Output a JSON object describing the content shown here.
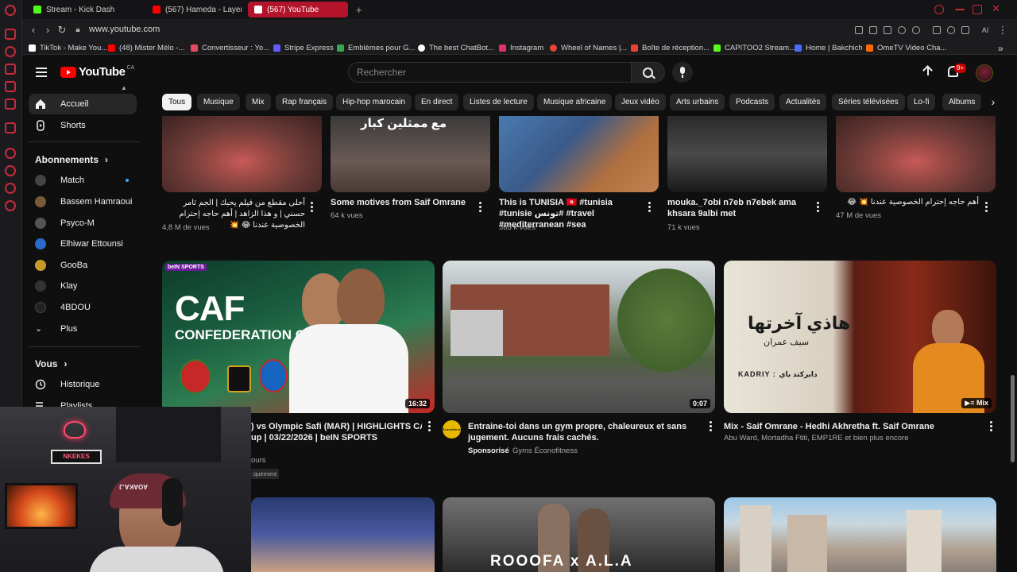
{
  "browser": {
    "tabs": [
      {
        "label": "Stream - Kick Dashboard",
        "color": "#53fc18"
      },
      {
        "label": "(567) Hameda - Layen",
        "color": "#ff0000"
      },
      {
        "label": "(567) YouTube",
        "color": "#ff0000",
        "active": true
      }
    ],
    "url": "www.youtube.com",
    "bookmarks": [
      {
        "label": "TikTok - Make You...",
        "color": "#ffffff"
      },
      {
        "label": "(48) Mister Mélo -...",
        "color": "#ff0000"
      },
      {
        "label": "Convertisseur : Yo...",
        "color": "#e84a5f"
      },
      {
        "label": "Stripe Express",
        "color": "#635bff"
      },
      {
        "label": "Emblèmes pour G...",
        "color": "#34a853"
      },
      {
        "label": "The best ChatBot...",
        "color": "#ffffff"
      },
      {
        "label": "Instagram",
        "color": "#e1306c"
      },
      {
        "label": "Wheel of Names |...",
        "color": "#ea4335"
      },
      {
        "label": "Boîte de réception...",
        "color": "#ea4335"
      },
      {
        "label": "CAPITOO2 Stream...",
        "color": "#53fc18"
      },
      {
        "label": "Home | Bakchich",
        "color": "#4a6cf7"
      },
      {
        "label": "OmeTV Video Cha...",
        "color": "#ff6a00"
      }
    ]
  },
  "header": {
    "logo_text": "YouTube",
    "logo_country": "CA",
    "search_placeholder": "Rechercher",
    "notification_count": "9+"
  },
  "sidebar": {
    "home": "Accueil",
    "shorts": "Shorts",
    "subscriptions_heading": "Abonnements",
    "channels": [
      {
        "name": "Match",
        "color": "#444444",
        "live_dot": true
      },
      {
        "name": "Bassem Hamraoui",
        "color": "#7a5a3a"
      },
      {
        "name": "Psyco-M",
        "color": "#555555"
      },
      {
        "name": "Elhiwar Ettounsi",
        "color": "#2a6ac8"
      },
      {
        "name": "GooBa",
        "color": "#c89a2a"
      },
      {
        "name": "Klay",
        "color": "#333333"
      },
      {
        "name": "4BDOU",
        "color": "#222222"
      }
    ],
    "more": "Plus",
    "you_heading": "Vous",
    "history": "Historique",
    "playlists": "Playlists"
  },
  "chips": [
    "Tous",
    "Musique",
    "Mix",
    "Rap français",
    "Hip-hop marocain",
    "En direct",
    "Listes de lecture",
    "Musique africaine",
    "Jeux vidéo",
    "Arts urbains",
    "Podcasts",
    "Actualités",
    "Séries télévisées",
    "Lo-fi",
    "Albums"
  ],
  "videos_row1": [
    {
      "title": "أحلى مقطع من فيلم يحبك | الجم ثامر حسني | و هذا الزاهد | أهم حاجه إحترام الخصوصية عندنا 😂 💥",
      "meta": "4,8 M de vues"
    },
    {
      "title": "Some motives from Saif Omrane",
      "meta": "64 k vues",
      "thumb_text": "مع ممثلين كبار"
    },
    {
      "title": "This is TUNISIA 🇹🇳 #tunisia #tunisie تونس# #travel #mediterranean #sea",
      "meta": "563 k vues"
    },
    {
      "title": "mouka._7obi n7eb n7ebek ama khsara 9albi met",
      "meta": "71 k vues"
    },
    {
      "title": "أهم حاجه إحترام الخصوصية عندنا 💥 😂",
      "meta": "47 M de vues"
    }
  ],
  "videos_row2": [
    {
      "title": ") vs Olympic Safi (MAR) | HIGHLIGHTS CAF",
      "title2": "up | 03/22/2026 | beIN SPORTS",
      "meta": "ours",
      "meta2": "quement",
      "duration": "16:32",
      "thumb_text_1": "CAF",
      "thumb_text_2": "CONFEDERATION CUP",
      "badge": "beIN SPORTS"
    },
    {
      "title": "Entraine-toi dans un gym propre, chaleureux et sans jugement. Aucuns frais cachés.",
      "sponsored": "Sponsorisé",
      "advertiser": "Gyms Éconofitness",
      "duration": "0:07",
      "channel_logo": "Éconofitness"
    },
    {
      "title": "Mix - Saif Omrane - Hedhi Akhretha ft. Saif Omrane",
      "meta": "Abu Ward, Mortadha Ftiti, EMP1RE et bien plus encore",
      "badge": "Mix",
      "thumb_text_1": "هاذي آخرتها",
      "thumb_text_2": "سيف عمران",
      "thumb_text_3": "KADRIY : دايركتد باي"
    }
  ],
  "videos_row3": [
    {
      "thumb_text": ""
    },
    {
      "thumb_text": "ROOOFA x A.L.A"
    },
    {
      "thumb_text": ""
    }
  ],
  "webcam": {
    "sign_text": "NKEKES",
    "cap_text": "AOAKA.J"
  }
}
